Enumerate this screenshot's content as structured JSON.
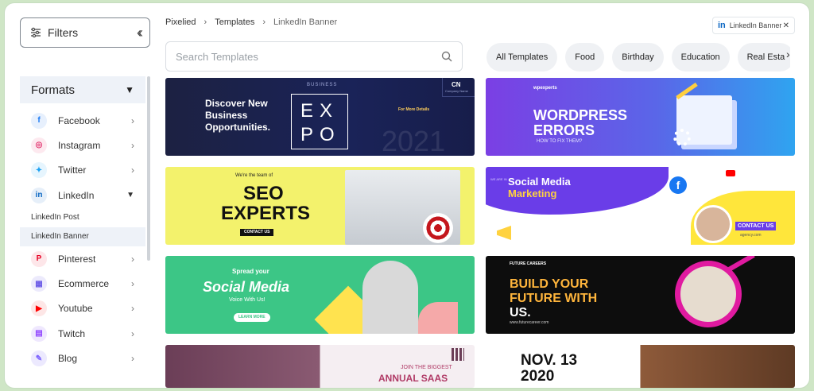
{
  "sidebar": {
    "filters_label": "Filters",
    "formats_label": "Formats",
    "items": [
      {
        "label": "Facebook",
        "icon": "facebook-icon",
        "color": "#1877f2"
      },
      {
        "label": "Instagram",
        "icon": "instagram-icon",
        "color": "#e1306c"
      },
      {
        "label": "Twitter",
        "icon": "twitter-icon",
        "color": "#1da1f2"
      },
      {
        "label": "LinkedIn",
        "icon": "linkedin-icon",
        "color": "#0a66c2"
      }
    ],
    "linkedin_sub": [
      "LinkedIn Post",
      "LinkedIn Banner"
    ],
    "more_items": [
      {
        "label": "Pinterest",
        "icon": "pinterest-icon",
        "color": "#e60023"
      },
      {
        "label": "Ecommerce",
        "icon": "ecommerce-icon",
        "color": "#6c5ce7"
      },
      {
        "label": "Youtube",
        "icon": "youtube-icon",
        "color": "#ff0000"
      },
      {
        "label": "Twitch",
        "icon": "twitch-icon",
        "color": "#9146ff"
      },
      {
        "label": "Blog",
        "icon": "blog-icon",
        "color": "#7b61ff"
      }
    ]
  },
  "breadcrumb": [
    "Pixelied",
    "Templates",
    "LinkedIn Banner"
  ],
  "active_tag": "LinkedIn Banner",
  "search": {
    "placeholder": "Search Templates"
  },
  "categories": [
    "All Templates",
    "Food",
    "Birthday",
    "Education",
    "Real Esta"
  ],
  "cards": {
    "expo": {
      "tag": "BUSINESS",
      "headline": "Discover New Business Opportunities.",
      "big1": "EX",
      "big2": "PO",
      "year": "2021",
      "logo": "CN",
      "logo_sub": "Company Name",
      "details": "For More Details"
    },
    "wordpress": {
      "brand": "wpexperts",
      "line1": "WORDPRESS",
      "line2": "ERRORS",
      "sub": "HOW TO FIX THEM?"
    },
    "seo": {
      "top": "We're the team of",
      "line1": "SEO",
      "line2": "EXPERTS",
      "cta": "CONTACT US"
    },
    "social_marketing": {
      "small": "WE ARE IN",
      "line1": "Social Media",
      "line2": "Marketing",
      "cta": "CONTACT US",
      "url": "agency.com"
    },
    "spread": {
      "top": "Spread your",
      "main": "Social Media",
      "sub": "Voice With Us!",
      "cta": "LEARN MORE"
    },
    "future": {
      "brand": "FUTURE CAREERS",
      "line1": "BUILD YOUR",
      "line2": "FUTURE WITH",
      "line3": "US.",
      "url": "www.futurecareer.com"
    },
    "saas": {
      "line1": "JOIN THE BIGGEST",
      "line2": "ANNUAL SAAS"
    },
    "nov": {
      "line1": "NOV. 13",
      "line2": "2020"
    }
  }
}
